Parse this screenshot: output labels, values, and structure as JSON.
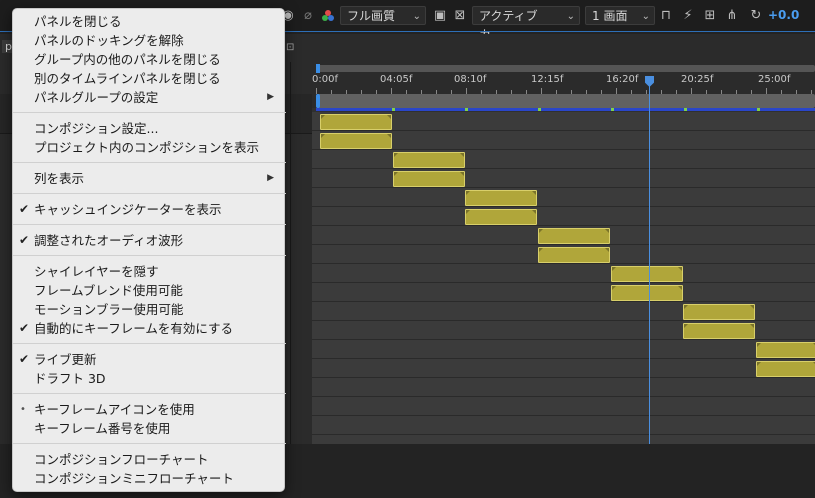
{
  "viewer_bar": {
    "resolution": "フル画質",
    "camera": "アクティブカ...",
    "view_layout": "1 画面",
    "exposure": "+0.0"
  },
  "left_tab_partial": "p",
  "ruler": {
    "labels": [
      "0:00f",
      "04:05f",
      "08:10f",
      "12:15f",
      "16:20f",
      "20:25f",
      "25:00f"
    ]
  },
  "context_menu": {
    "items": [
      {
        "label": "パネルを閉じる",
        "mark": "",
        "submenu": false
      },
      {
        "label": "パネルのドッキングを解除",
        "mark": "",
        "submenu": false
      },
      {
        "label": "グループ内の他のパネルを閉じる",
        "mark": "",
        "submenu": false
      },
      {
        "label": "別のタイムラインパネルを閉じる",
        "mark": "",
        "submenu": false
      },
      {
        "label": "パネルグループの設定",
        "mark": "",
        "submenu": true
      },
      {
        "label": "コンポジション設定...",
        "mark": "",
        "submenu": false
      },
      {
        "label": "プロジェクト内のコンポジションを表示",
        "mark": "",
        "submenu": false
      },
      {
        "label": "列を表示",
        "mark": "",
        "submenu": true
      },
      {
        "label": "キャッシュインジケーターを表示",
        "mark": "✔",
        "submenu": false
      },
      {
        "label": "調整されたオーディオ波形",
        "mark": "✔",
        "submenu": false
      },
      {
        "label": "シャイレイヤーを隠す",
        "mark": "",
        "submenu": false
      },
      {
        "label": "フレームブレンド使用可能",
        "mark": "",
        "submenu": false
      },
      {
        "label": "モーションブラー使用可能",
        "mark": "",
        "submenu": false
      },
      {
        "label": "自動的にキーフレームを有効にする",
        "mark": "✔",
        "submenu": false
      },
      {
        "label": "ライブ更新",
        "mark": "✔",
        "submenu": false
      },
      {
        "label": "ドラフト 3D",
        "mark": "",
        "submenu": false
      },
      {
        "label": "キーフレームアイコンを使用",
        "mark": "•",
        "submenu": false
      },
      {
        "label": "キーフレーム番号を使用",
        "mark": "",
        "submenu": false
      },
      {
        "label": "コンポジションフローチャート",
        "mark": "",
        "submenu": false
      },
      {
        "label": "コンポジションミニフローチャート",
        "mark": "",
        "submenu": false
      }
    ],
    "submenu_arrow": "▶"
  }
}
